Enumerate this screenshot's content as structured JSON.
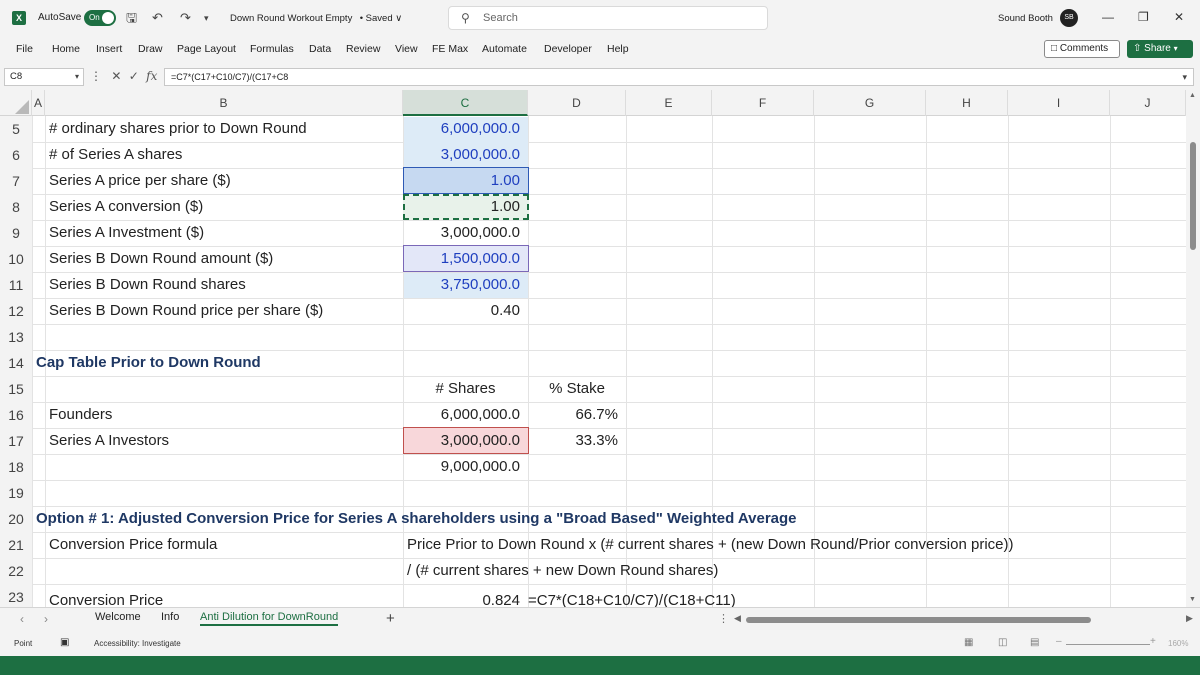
{
  "titlebar": {
    "autosave_label": "AutoSave",
    "autosave_state": "On",
    "doc_title": "Down Round Workout Empty  • Saved ∨",
    "search_placeholder": "Search",
    "user_name": "Sound Booth",
    "avatar_initials": "SB"
  },
  "menu": {
    "items": [
      "File",
      "Home",
      "Insert",
      "Draw",
      "Page Layout",
      "Formulas",
      "Data",
      "Review",
      "View",
      "FE Max",
      "Automate",
      "Developer",
      "Help"
    ],
    "comments_label": "Comments",
    "share_label": "Share"
  },
  "formula_bar": {
    "name_box": "C8",
    "formula": "=C7*(C17+C10/C7)/(C17+C8"
  },
  "columns": [
    "A",
    "B",
    "C",
    "D",
    "E",
    "F",
    "G",
    "H",
    "I",
    "J"
  ],
  "rows": {
    "numbers": [
      "5",
      "6",
      "7",
      "8",
      "9",
      "10",
      "11",
      "12",
      "13",
      "14",
      "15",
      "16",
      "17",
      "18",
      "19",
      "20",
      "21",
      "22",
      "23"
    ],
    "r5": {
      "label": "# ordinary shares prior to Down Round",
      "value": "6,000,000.0"
    },
    "r6": {
      "label": "# of Series A shares",
      "value": "3,000,000.0"
    },
    "r7": {
      "label": "Series A price per share ($)",
      "value": "1.00"
    },
    "r8": {
      "label": "Series A conversion ($)",
      "value": "1.00"
    },
    "r9": {
      "label": "Series A Investment ($)",
      "value": "3,000,000.0"
    },
    "r10": {
      "label": "Series B Down Round amount ($)",
      "value": "1,500,000.0"
    },
    "r11": {
      "label": "Series B Down Round shares",
      "value": "3,750,000.0"
    },
    "r12": {
      "label": "Series B Down Round price per share ($)",
      "value": "0.40"
    },
    "r14": {
      "heading": "Cap Table Prior to Down Round"
    },
    "r15": {
      "col_c": "# Shares",
      "col_d": "% Stake"
    },
    "r16": {
      "label": "Founders",
      "value": "6,000,000.0",
      "stake": "66.7%"
    },
    "r17": {
      "label": "Series A Investors",
      "value": "3,000,000.0",
      "stake": "33.3%"
    },
    "r18": {
      "value": "9,000,000.0"
    },
    "r20": {
      "heading": "Option # 1: Adjusted Conversion Price for Series A shareholders using a \"Broad Based\" Weighted Average"
    },
    "r21": {
      "label": "Conversion Price formula",
      "text": "Price Prior to Down Round x (# current shares + (new Down Round/Prior conversion price))"
    },
    "r22": {
      "text": "/ (# current shares + new Down Round shares)"
    },
    "r23": {
      "label": "Conversion Price",
      "value": "0.824",
      "formula": "=C7*(C18+C10/C7)/(C18+C11)"
    }
  },
  "sheets": {
    "tabs": [
      "Welcome",
      "Info",
      "Anti Dilution for DownRound"
    ],
    "active": "Anti Dilution for DownRound"
  },
  "status": {
    "mode": "Point",
    "accessibility": "Accessibility: Investigate",
    "zoom": "160%"
  },
  "colors": {
    "accent": "#1d6f42",
    "input_blue": "#1f3fbf",
    "heading_navy": "#1f3864"
  }
}
